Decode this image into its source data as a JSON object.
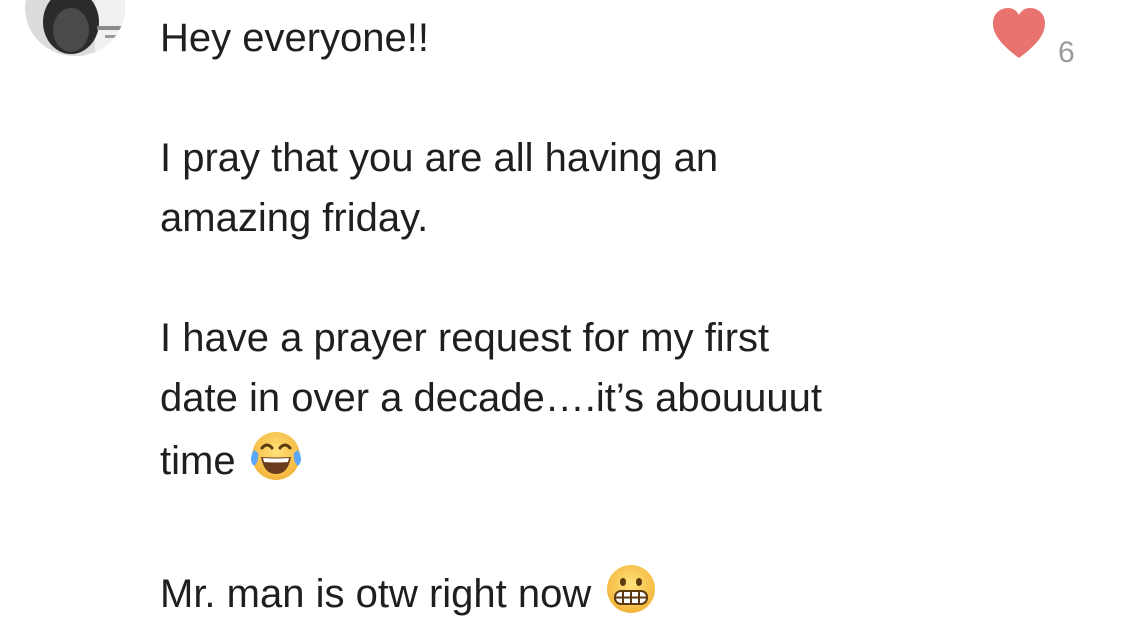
{
  "post": {
    "greeting": "Hey everyone!!",
    "p1_line1": "I pray that you are all having an",
    "p1_line2": "amazing friday.",
    "p2_line1": "I have a prayer request for my first",
    "p2_line2": "date in over a decade….it’s abouuuut",
    "p2_line3": "time",
    "p3_line1": "Mr. man is otw right now"
  },
  "likes": {
    "count": "6",
    "icon": "heart-icon",
    "color": "#e8736f"
  },
  "emojis": {
    "laughing": "tears-of-joy-emoji-icon",
    "grimacing": "grimacing-emoji-icon"
  }
}
